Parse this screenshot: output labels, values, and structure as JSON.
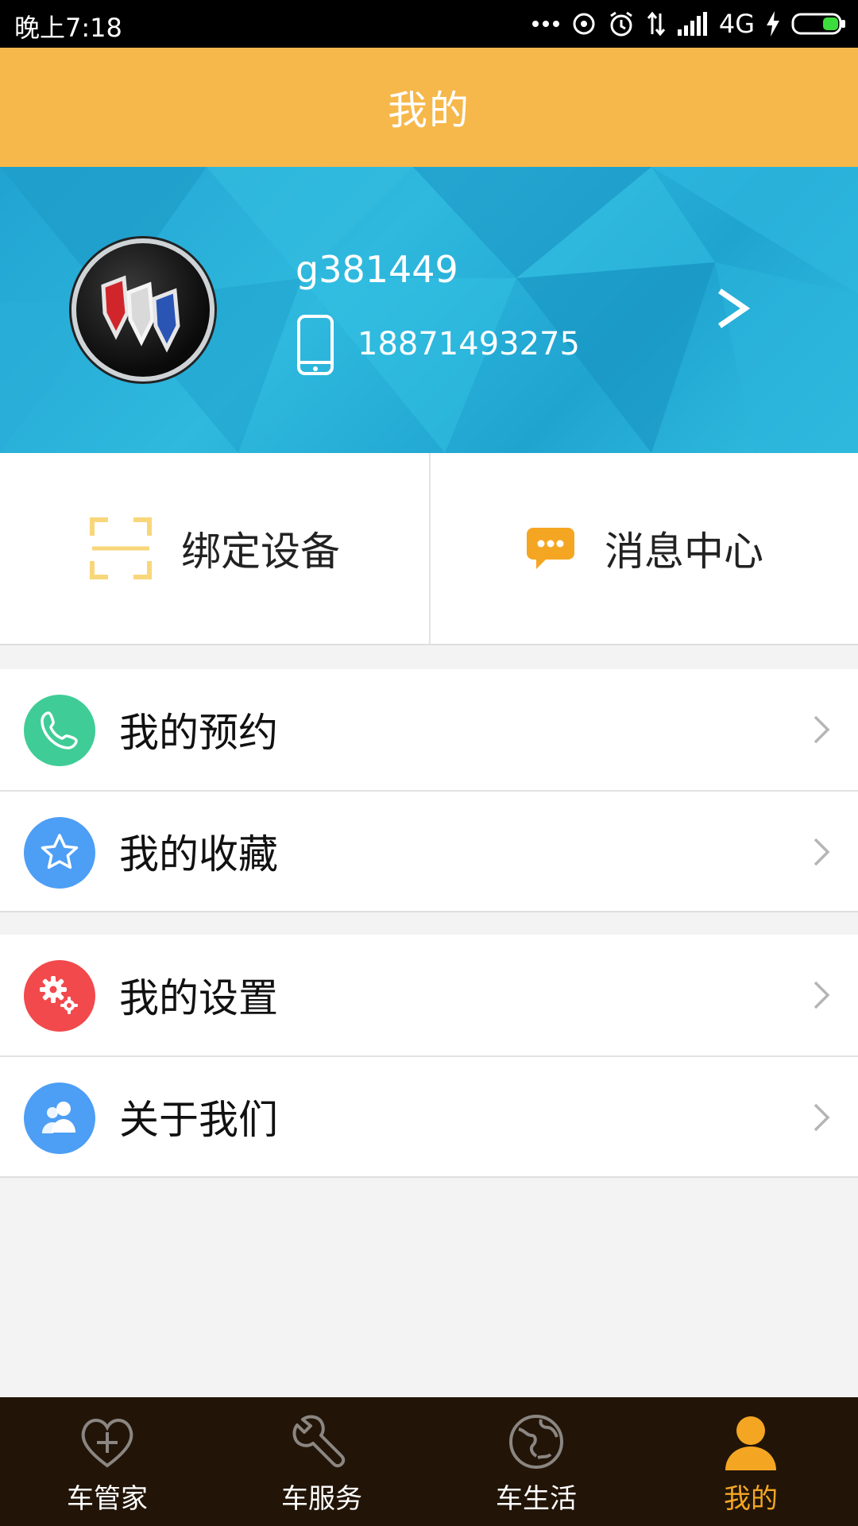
{
  "status_bar": {
    "time": "晚上7:18",
    "network": "4G"
  },
  "header": {
    "title": "我的"
  },
  "profile": {
    "username": "g381449",
    "phone": "18871493275"
  },
  "quick_actions": [
    {
      "label": "绑定设备",
      "icon": "scan-frame-icon"
    },
    {
      "label": "消息中心",
      "icon": "chat-bubble-icon"
    }
  ],
  "menu": {
    "group1": [
      {
        "label": "我的预约",
        "icon": "phone-icon",
        "color": "#3fcc97"
      },
      {
        "label": "我的收藏",
        "icon": "star-icon",
        "color": "#4d9ef5"
      }
    ],
    "group2": [
      {
        "label": "我的设置",
        "icon": "gears-icon",
        "color": "#f2494c"
      },
      {
        "label": "关于我们",
        "icon": "people-icon",
        "color": "#4d9ef5"
      }
    ]
  },
  "bottom_nav": [
    {
      "label": "车管家",
      "icon": "heart-plus-icon"
    },
    {
      "label": "车服务",
      "icon": "wrench-icon"
    },
    {
      "label": "车生活",
      "icon": "globe-icon"
    },
    {
      "label": "我的",
      "icon": "person-icon",
      "active": true
    }
  ],
  "colors": {
    "header": "#f6b84b",
    "accent": "#f4a623",
    "nav_bg": "#221508"
  }
}
